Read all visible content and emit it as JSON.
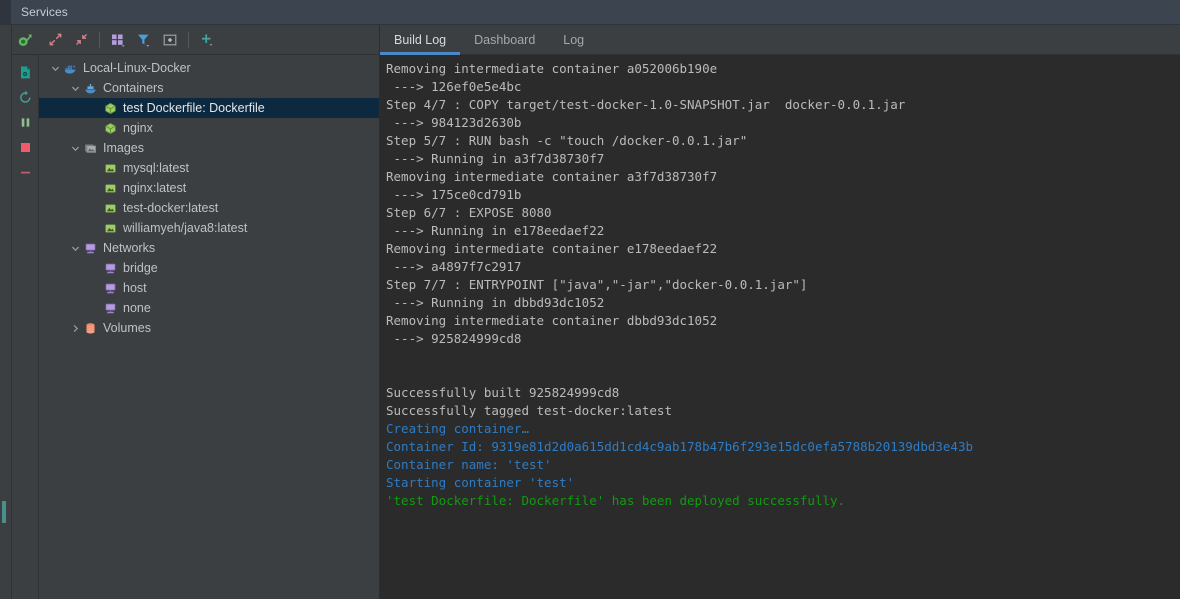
{
  "window": {
    "title": "Services"
  },
  "toolbar": {
    "run_items": [
      {
        "name": "docker-file-icon",
        "label": "Deploy Dockerfile"
      },
      {
        "name": "rerun-icon",
        "label": "Rerun"
      },
      {
        "name": "pause-icon",
        "label": "Pause"
      },
      {
        "name": "stop-icon",
        "label": "Stop"
      },
      {
        "name": "minus-icon",
        "label": "Remove"
      }
    ],
    "main_items": [
      {
        "name": "expand-all-icon",
        "label": "Expand All"
      },
      {
        "name": "collapse-all-icon",
        "label": "Collapse All"
      },
      {
        "name": "group-icon",
        "label": "Group By"
      },
      {
        "name": "filter-icon",
        "label": "Filter"
      },
      {
        "name": "show-in-new-window-icon",
        "label": "Open in New Window"
      },
      {
        "name": "add-icon",
        "label": "Add Service"
      }
    ]
  },
  "tree": {
    "items": [
      {
        "indent": 0,
        "twisty": "v",
        "icon": "docker-icon",
        "label": "Local-Linux-Docker",
        "selected": false
      },
      {
        "indent": 1,
        "twisty": "v",
        "icon": "ship-icon",
        "label": "Containers",
        "selected": false
      },
      {
        "indent": 2,
        "twisty": "",
        "icon": "container-icon",
        "label": "test Dockerfile: Dockerfile",
        "selected": true
      },
      {
        "indent": 2,
        "twisty": "",
        "icon": "container-icon",
        "label": "nginx",
        "selected": false
      },
      {
        "indent": 1,
        "twisty": "v",
        "icon": "images-icon",
        "label": "Images",
        "selected": false
      },
      {
        "indent": 2,
        "twisty": "",
        "icon": "image-icon",
        "label": "mysql:latest",
        "selected": false
      },
      {
        "indent": 2,
        "twisty": "",
        "icon": "image-icon",
        "label": "nginx:latest",
        "selected": false
      },
      {
        "indent": 2,
        "twisty": "",
        "icon": "image-icon",
        "label": "test-docker:latest",
        "selected": false
      },
      {
        "indent": 2,
        "twisty": "",
        "icon": "image-icon",
        "label": "williamyeh/java8:latest",
        "selected": false
      },
      {
        "indent": 1,
        "twisty": "v",
        "icon": "network-icon",
        "label": "Networks",
        "selected": false
      },
      {
        "indent": 2,
        "twisty": "",
        "icon": "network-icon",
        "label": "bridge",
        "selected": false
      },
      {
        "indent": 2,
        "twisty": "",
        "icon": "network-icon",
        "label": "host",
        "selected": false
      },
      {
        "indent": 2,
        "twisty": "",
        "icon": "network-icon",
        "label": "none",
        "selected": false
      },
      {
        "indent": 1,
        "twisty": ">",
        "icon": "volumes-icon",
        "label": "Volumes",
        "selected": false
      }
    ]
  },
  "tabs": [
    {
      "label": "Build Log",
      "active": true
    },
    {
      "label": "Dashboard",
      "active": false
    },
    {
      "label": "Log",
      "active": false
    }
  ],
  "console": {
    "lines": [
      {
        "text": "Removing intermediate container a052006b190e",
        "color": "default"
      },
      {
        "text": " ---> 126ef0e5e4bc",
        "color": "default"
      },
      {
        "text": "Step 4/7 : COPY target/test-docker-1.0-SNAPSHOT.jar  docker-0.0.1.jar",
        "color": "default"
      },
      {
        "text": " ---> 984123d2630b",
        "color": "default"
      },
      {
        "text": "Step 5/7 : RUN bash -c \"touch /docker-0.0.1.jar\"",
        "color": "default"
      },
      {
        "text": " ---> Running in a3f7d38730f7",
        "color": "default"
      },
      {
        "text": "Removing intermediate container a3f7d38730f7",
        "color": "default"
      },
      {
        "text": " ---> 175ce0cd791b",
        "color": "default"
      },
      {
        "text": "Step 6/7 : EXPOSE 8080",
        "color": "default"
      },
      {
        "text": " ---> Running in e178eedaef22",
        "color": "default"
      },
      {
        "text": "Removing intermediate container e178eedaef22",
        "color": "default"
      },
      {
        "text": " ---> a4897f7c2917",
        "color": "default"
      },
      {
        "text": "Step 7/7 : ENTRYPOINT [\"java\",\"-jar\",\"docker-0.0.1.jar\"]",
        "color": "default"
      },
      {
        "text": " ---> Running in dbbd93dc1052",
        "color": "default"
      },
      {
        "text": "Removing intermediate container dbbd93dc1052",
        "color": "default"
      },
      {
        "text": " ---> 925824999cd8",
        "color": "default"
      },
      {
        "text": "",
        "color": "blank"
      },
      {
        "text": "",
        "color": "blank"
      },
      {
        "text": "Successfully built 925824999cd8",
        "color": "default"
      },
      {
        "text": "Successfully tagged test-docker:latest",
        "color": "default"
      },
      {
        "text": "Creating container…",
        "color": "blue"
      },
      {
        "text": "Container Id: 9319e81d2d0a615dd1cd4c9ab178b47b6f293e15dc0efa5788b20139dbd3e43b",
        "color": "blue"
      },
      {
        "text": "Container name: 'test'",
        "color": "blue"
      },
      {
        "text": "Starting container 'test'",
        "color": "blue"
      },
      {
        "text": "'test Dockerfile: Dockerfile' has been deployed successfully.",
        "color": "green"
      }
    ]
  },
  "colors": {
    "accent_blue": "#4a88c7",
    "log_blue": "#2e7cc4",
    "log_green": "#109b10",
    "selection": "#0d293f",
    "console_bg": "#2b2b2b",
    "panel_bg": "#3c3f41",
    "titlebar_bg": "#3c4450"
  }
}
